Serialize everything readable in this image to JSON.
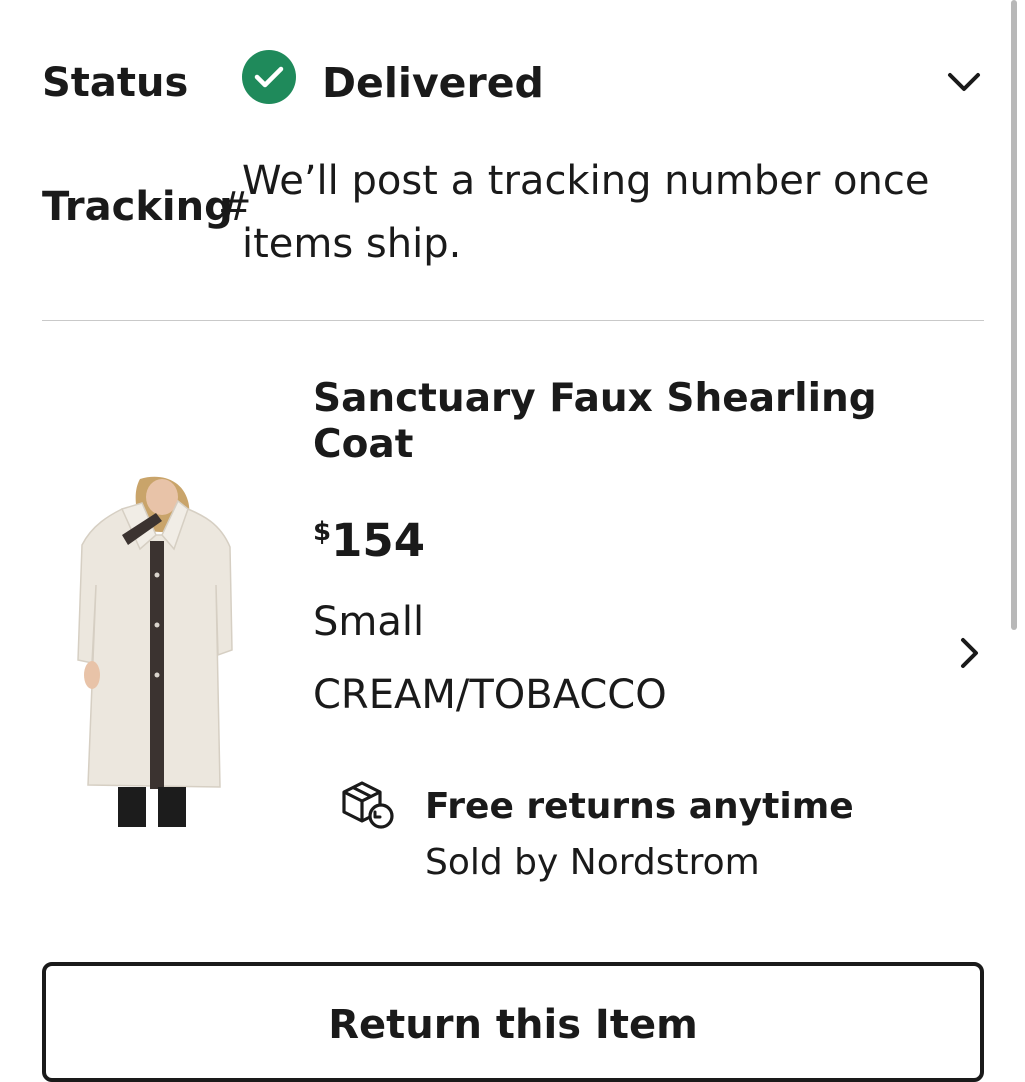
{
  "status": {
    "label": "Status",
    "value": "Delivered",
    "icon": "check-circle-icon",
    "color": "#1f8a5b"
  },
  "tracking": {
    "label": "Tracking",
    "hash": "#",
    "note": "We’ll post a tracking number once items ship."
  },
  "item": {
    "name": "Sanctuary Faux Shearling Coat",
    "price_currency": "$",
    "price_amount": "154",
    "size": "Small",
    "color": "CREAM/TOBACCO",
    "image_icon": "product-image-coat"
  },
  "returns": {
    "title": "Free returns anytime",
    "sold_by": "Sold by Nordstrom",
    "icon": "package-return-icon"
  },
  "actions": {
    "return_label": "Return this Item"
  }
}
